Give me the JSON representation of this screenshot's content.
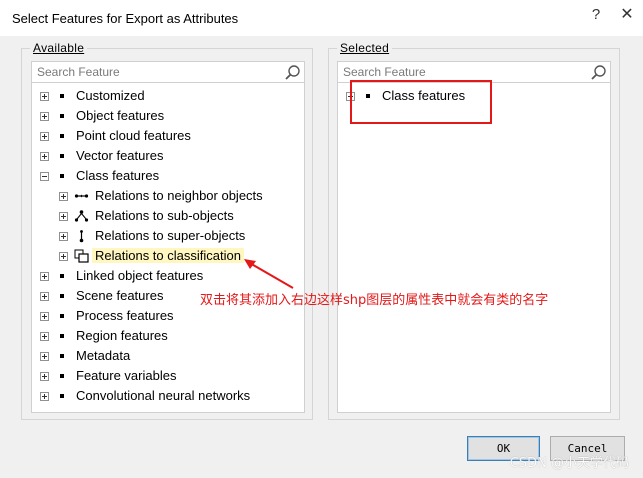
{
  "window": {
    "title": "Select Features for Export as Attributes",
    "help_glyph": "?",
    "close_glyph": "✕"
  },
  "available": {
    "legend": "Available",
    "search_placeholder": "Search Feature",
    "items": [
      {
        "label": "Customized",
        "level": 0,
        "expander": "collapsed",
        "icon": "bullet"
      },
      {
        "label": "Object features",
        "level": 0,
        "expander": "collapsed",
        "icon": "bullet"
      },
      {
        "label": "Point cloud features",
        "level": 0,
        "expander": "collapsed",
        "icon": "bullet"
      },
      {
        "label": "Vector features",
        "level": 0,
        "expander": "collapsed",
        "icon": "bullet"
      },
      {
        "label": "Class features",
        "level": 0,
        "expander": "expanded",
        "icon": "bullet"
      },
      {
        "label": "Relations to neighbor objects",
        "level": 1,
        "expander": "collapsed",
        "icon": "neighbor-relation-icon"
      },
      {
        "label": "Relations to sub-objects",
        "level": 1,
        "expander": "collapsed",
        "icon": "sub-objects-icon"
      },
      {
        "label": "Relations to super-objects",
        "level": 1,
        "expander": "collapsed",
        "icon": "super-objects-icon"
      },
      {
        "label": "Relations to classification",
        "level": 1,
        "expander": "collapsed",
        "icon": "classification-icon",
        "highlighted": true
      },
      {
        "label": "Linked object features",
        "level": 0,
        "expander": "collapsed",
        "icon": "bullet"
      },
      {
        "label": "Scene features",
        "level": 0,
        "expander": "collapsed",
        "icon": "bullet"
      },
      {
        "label": "Process features",
        "level": 0,
        "expander": "collapsed",
        "icon": "bullet"
      },
      {
        "label": "Region features",
        "level": 0,
        "expander": "collapsed",
        "icon": "bullet"
      },
      {
        "label": "Metadata",
        "level": 0,
        "expander": "collapsed",
        "icon": "bullet"
      },
      {
        "label": "Feature variables",
        "level": 0,
        "expander": "collapsed",
        "icon": "bullet"
      },
      {
        "label": "Convolutional neural networks",
        "level": 0,
        "expander": "collapsed",
        "icon": "bullet"
      }
    ]
  },
  "selected": {
    "legend": "Selected",
    "search_placeholder": "Search Feature",
    "items": [
      {
        "label": "Class features",
        "level": 0,
        "expander": "collapsed",
        "icon": "bullet"
      }
    ]
  },
  "annotation": {
    "text": "双击将其添加入右边这样shp图层的属性表中就会有类的名字",
    "color": "#e31818"
  },
  "buttons": {
    "ok": "OK",
    "cancel": "Cancel"
  },
  "watermark": "CSDN @小天学代码",
  "colors": {
    "highlight": "#fff6c0",
    "annotation_red": "#e31818",
    "client_bg": "#f0f0f0"
  }
}
